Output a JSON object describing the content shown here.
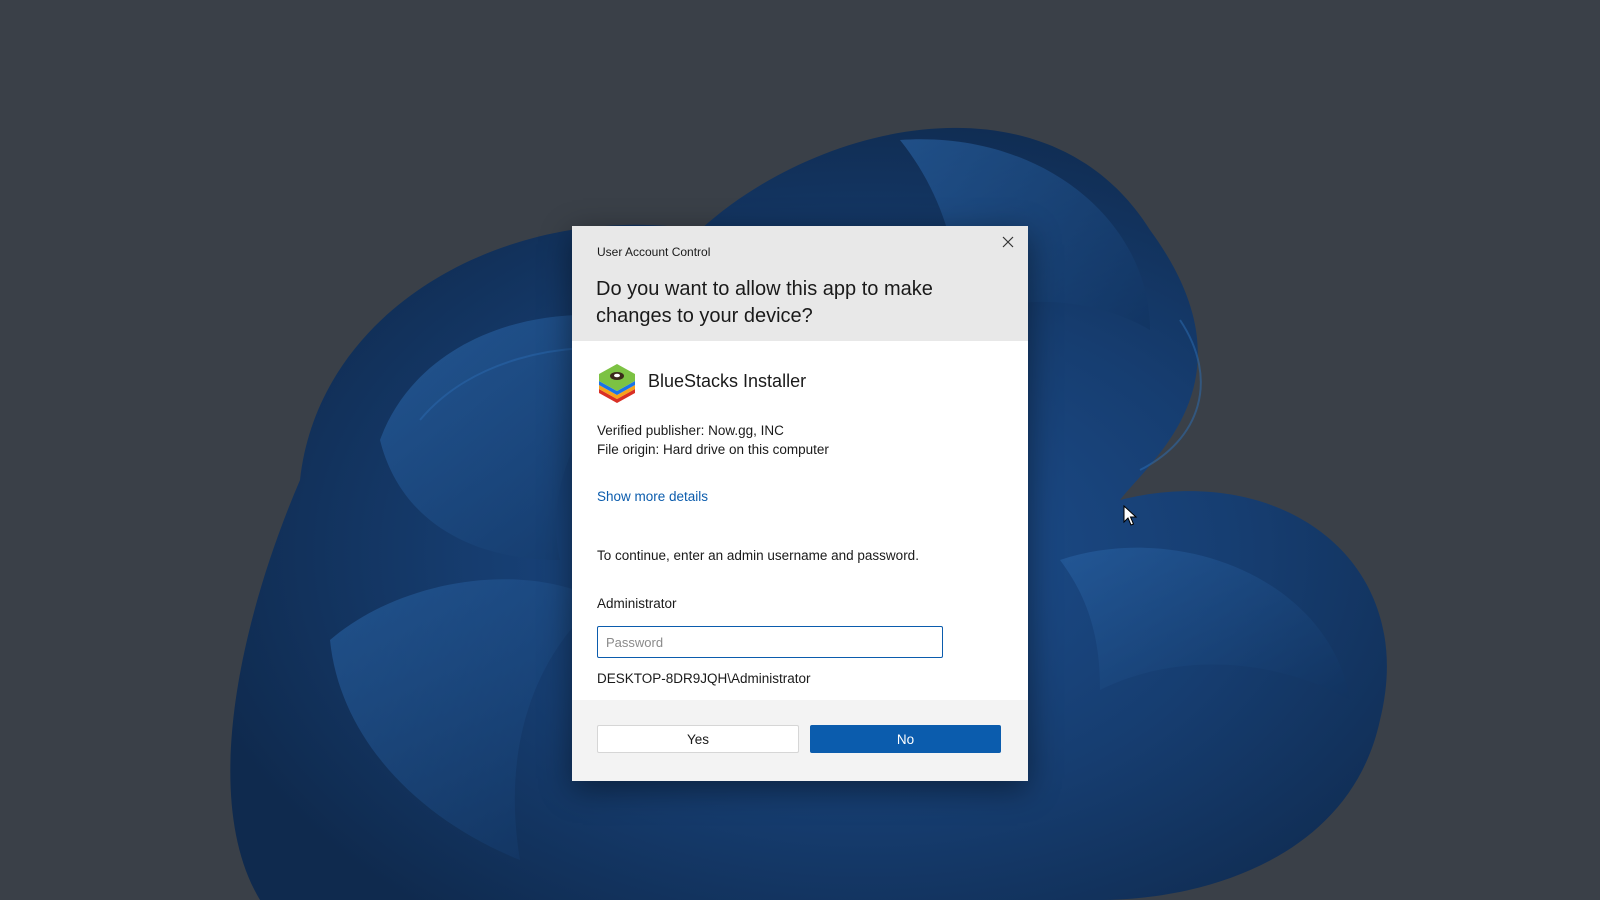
{
  "dialog": {
    "window_title": "User Account Control",
    "question": "Do you want to allow this app to make changes to your device?",
    "close_icon": "close-icon"
  },
  "app": {
    "name": "BlueStacks Installer",
    "icon": "bluestacks-icon",
    "publisher": "Verified publisher: Now.gg, INC",
    "origin": "File origin: Hard drive on this computer",
    "details_link": "Show more details"
  },
  "credentials": {
    "instruction": "To continue, enter an admin username and password.",
    "username": "Administrator",
    "password_value": "",
    "password_placeholder": "Password",
    "account_path": "DESKTOP-8DR9JQH\\Administrator"
  },
  "buttons": {
    "yes_label": "Yes",
    "no_label": "No"
  },
  "colors": {
    "accent": "#0b5cad",
    "header_bg": "#e8e8e8",
    "footer_bg": "#f3f3f3",
    "desktop_bg": "#3a4048"
  }
}
